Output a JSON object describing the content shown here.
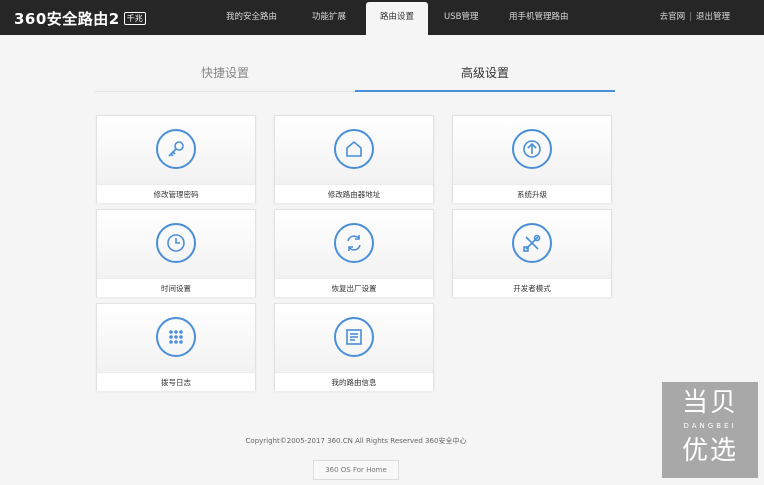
{
  "header": {
    "logo": "360安全路由2",
    "logo_badge": "千兆",
    "nav": [
      "我的安全路由",
      "功能扩展",
      "路由设置",
      "USB管理",
      "用手机管理路由"
    ],
    "active_nav": "路由设置",
    "links": [
      "去官网",
      "退出管理"
    ],
    "separator": "|"
  },
  "tabs": [
    "快捷设置",
    "高级设置"
  ],
  "active_tab": "高级设置",
  "cards": [
    {
      "label": "修改管理密码",
      "icon": "key-icon"
    },
    {
      "label": "修改路由器地址",
      "icon": "home-icon"
    },
    {
      "label": "系统升级",
      "icon": "upgrade-arrow-icon"
    },
    {
      "label": "时间设置",
      "icon": "clock-icon"
    },
    {
      "label": "恢复出厂设置",
      "icon": "reset-icon"
    },
    {
      "label": "开发者模式",
      "icon": "tools-icon"
    },
    {
      "label": "拨号日志",
      "icon": "dialpad-icon"
    },
    {
      "label": "我的路由信息",
      "icon": "info-document-icon"
    }
  ],
  "footer": {
    "copyright": "Copyright©2005-2017 360.CN All Rights Reserved 360安全中心",
    "os_button": "360 OS For Home"
  },
  "watermark": {
    "top": "当贝",
    "middle": "DANGBEI",
    "bottom": "优选"
  },
  "colors": {
    "accent": "#4a8fd8",
    "topbar": "#262626",
    "background": "#f5f5f5"
  }
}
